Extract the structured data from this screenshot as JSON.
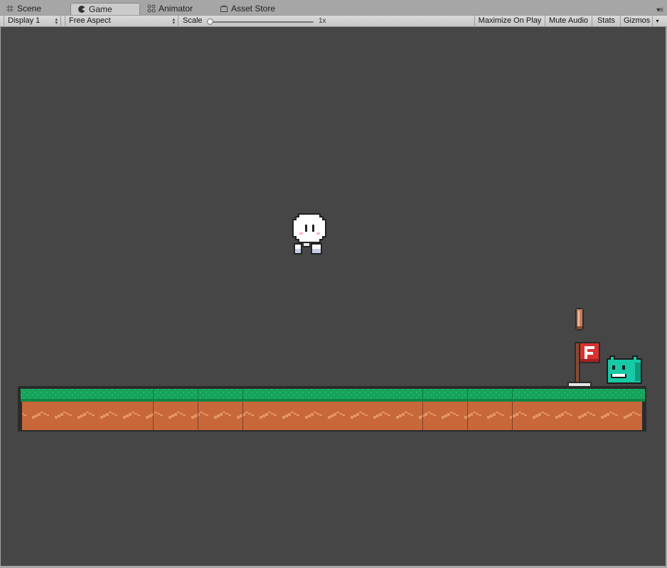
{
  "tabs": [
    {
      "label": "Scene",
      "icon": "grid-icon",
      "active": false
    },
    {
      "label": "Game",
      "icon": "game-icon",
      "active": true
    },
    {
      "label": "Animator",
      "icon": "animator-icon",
      "active": false
    },
    {
      "label": "Asset Store",
      "icon": "store-icon",
      "active": false
    }
  ],
  "toolbar": {
    "display": "Display 1",
    "aspect": "Free Aspect",
    "scale_label": "Scale",
    "scale_value_text": "1x",
    "scale_fraction": 0.0,
    "maximize_on_play": "Maximize On Play",
    "mute_audio": "Mute Audio",
    "stats": "Stats",
    "gizmos": "Gizmos"
  },
  "game": {
    "background_color": "#464646",
    "flag_letter": "F",
    "objects": [
      "player-character",
      "coin-pickup",
      "goal-flag",
      "teal-cat-enemy",
      "ground-platform"
    ]
  },
  "colors": {
    "grass": "#16a05a",
    "dirt": "#c8683a",
    "dirt_zigzag": "#e59563",
    "flag": "#d93030",
    "teal": "#18c9a5"
  }
}
